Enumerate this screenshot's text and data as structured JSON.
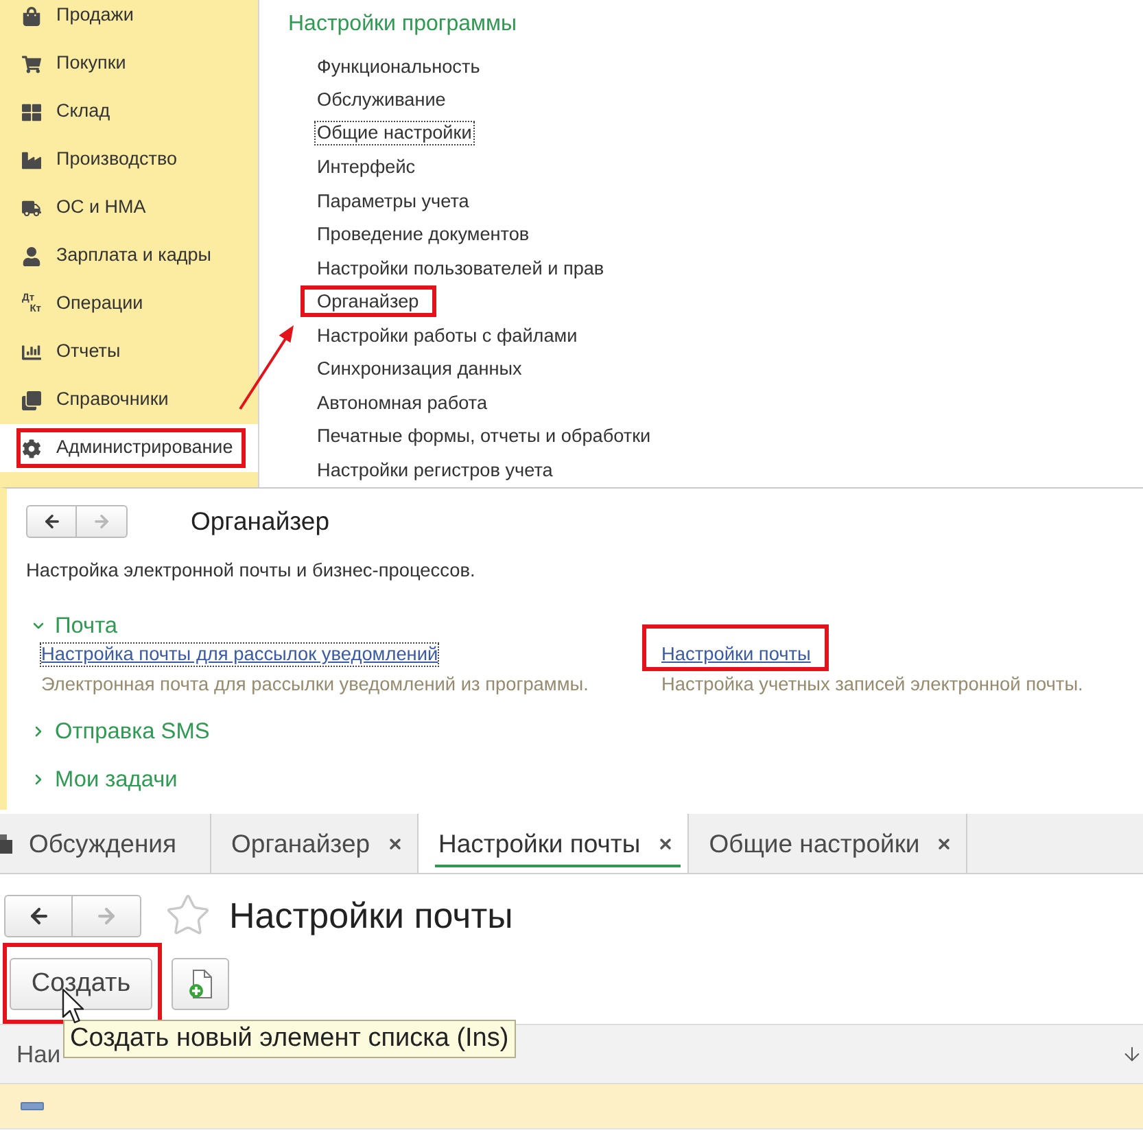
{
  "sidebar": {
    "items": [
      {
        "label": "Продажи",
        "selected": false,
        "highlighted": false
      },
      {
        "label": "Покупки",
        "selected": false,
        "highlighted": false
      },
      {
        "label": "Склад",
        "selected": false,
        "highlighted": false
      },
      {
        "label": "Производство",
        "selected": false,
        "highlighted": false
      },
      {
        "label": "ОС и НМА",
        "selected": false,
        "highlighted": false
      },
      {
        "label": "Зарплата и кадры",
        "selected": false,
        "highlighted": false
      },
      {
        "label": "Операции",
        "icon_text": [
          "Дт",
          "Кт"
        ],
        "selected": false,
        "highlighted": false
      },
      {
        "label": "Отчеты",
        "selected": false,
        "highlighted": false
      },
      {
        "label": "Справочники",
        "selected": false,
        "highlighted": false
      },
      {
        "label": "Администрирование",
        "selected": true,
        "highlighted": true
      }
    ]
  },
  "settings_menu": {
    "title": "Настройки программы",
    "items": [
      {
        "label": "Функциональность",
        "focused": false,
        "highlighted": false
      },
      {
        "label": "Обслуживание",
        "focused": false,
        "highlighted": false
      },
      {
        "label": "Общие настройки",
        "focused": true,
        "highlighted": false
      },
      {
        "label": "Интерфейс",
        "focused": false,
        "highlighted": false
      },
      {
        "label": "Параметры учета",
        "focused": false,
        "highlighted": false
      },
      {
        "label": "Проведение документов",
        "focused": false,
        "highlighted": false
      },
      {
        "label": "Настройки пользователей и прав",
        "focused": false,
        "highlighted": false
      },
      {
        "label": "Органайзер",
        "focused": false,
        "highlighted": true
      },
      {
        "label": "Настройки работы с файлами",
        "focused": false,
        "highlighted": false
      },
      {
        "label": "Синхронизация данных",
        "focused": false,
        "highlighted": false
      },
      {
        "label": "Автономная работа",
        "focused": false,
        "highlighted": false
      },
      {
        "label": "Печатные формы, отчеты и обработки",
        "focused": false,
        "highlighted": false
      },
      {
        "label": "Настройки регистров учета",
        "focused": false,
        "highlighted": false
      }
    ]
  },
  "organizer": {
    "nav": {
      "back_disabled": false,
      "forward_disabled": true
    },
    "title": "Органайзер",
    "description": "Настройка электронной почты и бизнес-процессов.",
    "sections": [
      {
        "title": "Почта",
        "expanded": true,
        "links": [
          {
            "label": "Настройка почты для рассылок уведомлений",
            "description": "Электронная почта для рассылки уведомлений из программы.",
            "focused": true,
            "highlighted": false
          },
          {
            "label": "Настройки почты",
            "description": "Настройка учетных записей электронной почты.",
            "focused": false,
            "highlighted": true
          }
        ]
      },
      {
        "title": "Отправка SMS",
        "expanded": false
      },
      {
        "title": "Мои задачи",
        "expanded": false
      }
    ]
  },
  "tabs": [
    {
      "label": "Обсуждения",
      "selected": false,
      "closable": false
    },
    {
      "label": "Органайзер",
      "selected": false,
      "closable": true
    },
    {
      "label": "Настройки почты",
      "selected": true,
      "closable": true
    },
    {
      "label": "Общие настройки",
      "selected": false,
      "closable": true
    }
  ],
  "mail_settings": {
    "nav": {
      "back_disabled": false,
      "forward_disabled": true
    },
    "title": "Настройки почты",
    "favorite": false,
    "toolbar": [
      {
        "kind": "text",
        "label": "Создать",
        "highlighted": true
      },
      {
        "kind": "icon",
        "highlighted": false
      }
    ],
    "tooltip": "Создать новый элемент списка (Ins)",
    "table": {
      "columns": [
        "Наи"
      ],
      "rows": [
        {
          "selected": true
        }
      ]
    }
  }
}
